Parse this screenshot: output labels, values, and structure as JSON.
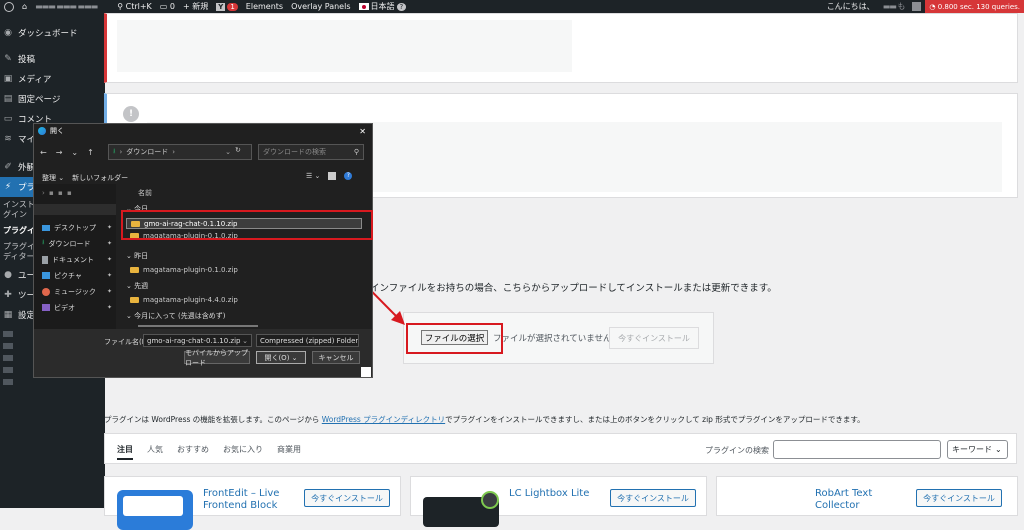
{
  "adminbar": {
    "site_name": "▬▬▬ ▬▬▬ ▬▬▬",
    "search_shortcut": "Ctrl+K",
    "comment_count": "0",
    "new_label": "新規",
    "yoast_label": "Y",
    "yoast_badge": "1",
    "elements_label": "Elements",
    "overlay_label": "Overlay Panels",
    "language_label": "日本語",
    "help_label": "?",
    "greeting": "こんにちは、",
    "user_name": "▬▬ も",
    "qm_label": "0.800 sec. 130 queries."
  },
  "sidebar": {
    "items": [
      {
        "label": "ダッシュボード",
        "icon": "dashboard-icon",
        "glyph": "◉"
      },
      {
        "label": "投稿",
        "icon": "pin-icon",
        "glyph": "✎"
      },
      {
        "label": "メディア",
        "icon": "media-icon",
        "glyph": "▣"
      },
      {
        "label": "固定ページ",
        "icon": "page-icon",
        "glyph": "▤"
      },
      {
        "label": "コメント",
        "icon": "comment-icon",
        "glyph": "▭"
      },
      {
        "label": "マイ",
        "icon": "feed-icon",
        "glyph": "≋"
      },
      {
        "label": "外観",
        "icon": "appearance-icon",
        "glyph": "✐"
      },
      {
        "label": "プラ",
        "icon": "plugin-icon",
        "glyph": "⚡"
      }
    ],
    "sub_installed": "インスト",
    "sub_installed2": "グイン",
    "sub_new": "プラグイ",
    "sub_editor": "プラグイ",
    "sub_editor2": "ディター",
    "items2": [
      {
        "label": "ユー",
        "icon": "users-icon",
        "glyph": "●"
      },
      {
        "label": "ツー",
        "icon": "tools-icon",
        "glyph": "✚"
      },
      {
        "label": "設定",
        "icon": "settings-icon",
        "glyph": "▦"
      }
    ]
  },
  "upload": {
    "description": "インファイルをお持ちの場合、こちらからアップロードしてインストールまたは更新できます。",
    "choose_file": "ファイルの選択",
    "no_file": "ファイルが選択されていません",
    "install_now": "今すぐインストール"
  },
  "plugins": {
    "intro_prefix": "プラグインは WordPress の機能を拡張します。このページから ",
    "intro_link": "WordPress プラグインディレクトリ",
    "intro_suffix": "でプラグインをインストールできますし、または上のボタンをクリックして zip 形式でプラグインをアップロードできます。",
    "tabs": [
      "注目",
      "人気",
      "おすすめ",
      "お気に入り",
      "商業用"
    ],
    "search_label": "プラグインの検索",
    "search_type": "キーワード",
    "cards": [
      {
        "title": "FrontEdit – Live Frontend Block",
        "title2": "",
        "button": "今すぐインストール"
      },
      {
        "title": "LC Lightbox Lite",
        "title2": "",
        "button": "今すぐインストール"
      },
      {
        "title": "RobArt Text",
        "title2": "Collector",
        "button": "今すぐインストール"
      }
    ]
  },
  "dialog": {
    "title": "開く",
    "path": "ダウンロード",
    "search_placeholder": "ダウンロードの検索",
    "organize": "整理",
    "new_folder": "新しいフォルダー",
    "column_name": "名前",
    "quick_access": [
      {
        "label": "デスクトップ",
        "color": "#3a96dd"
      },
      {
        "label": "ダウンロード",
        "color": "#25a162"
      },
      {
        "label": "ドキュメント",
        "color": "#9aa0a6"
      },
      {
        "label": "ピクチャ",
        "color": "#3a96dd"
      },
      {
        "label": "ミュージック",
        "color": "#e0674c"
      },
      {
        "label": "ビデオ",
        "color": "#8661c5"
      }
    ],
    "groups": [
      {
        "header": "今日",
        "files": [
          "gmo-ai-rag-chat-0.1.10.zip",
          "magatama-plugin-0.1.0.zip"
        ]
      },
      {
        "header": "昨日",
        "files": [
          "magatama-plugin-0.1.0.zip"
        ]
      },
      {
        "header": "先週",
        "files": [
          "magatama-plugin-4.4.0.zip"
        ]
      },
      {
        "header": "今月に入って (先週は含めず)",
        "files": []
      }
    ],
    "filename_label": "ファイル名(N):",
    "filename_value": "gmo-ai-rag-chat-0.1.10.zip",
    "filetype_value": "Compressed (zipped) Folder (*.z",
    "upload_mobile": "モバイルからアップロード",
    "open_button": "開く(O)",
    "cancel_button": "キャンセル"
  },
  "colors": {
    "accent": "#2271b1",
    "highlight_box": "#d7191f",
    "adminbar": "#1d2327"
  }
}
